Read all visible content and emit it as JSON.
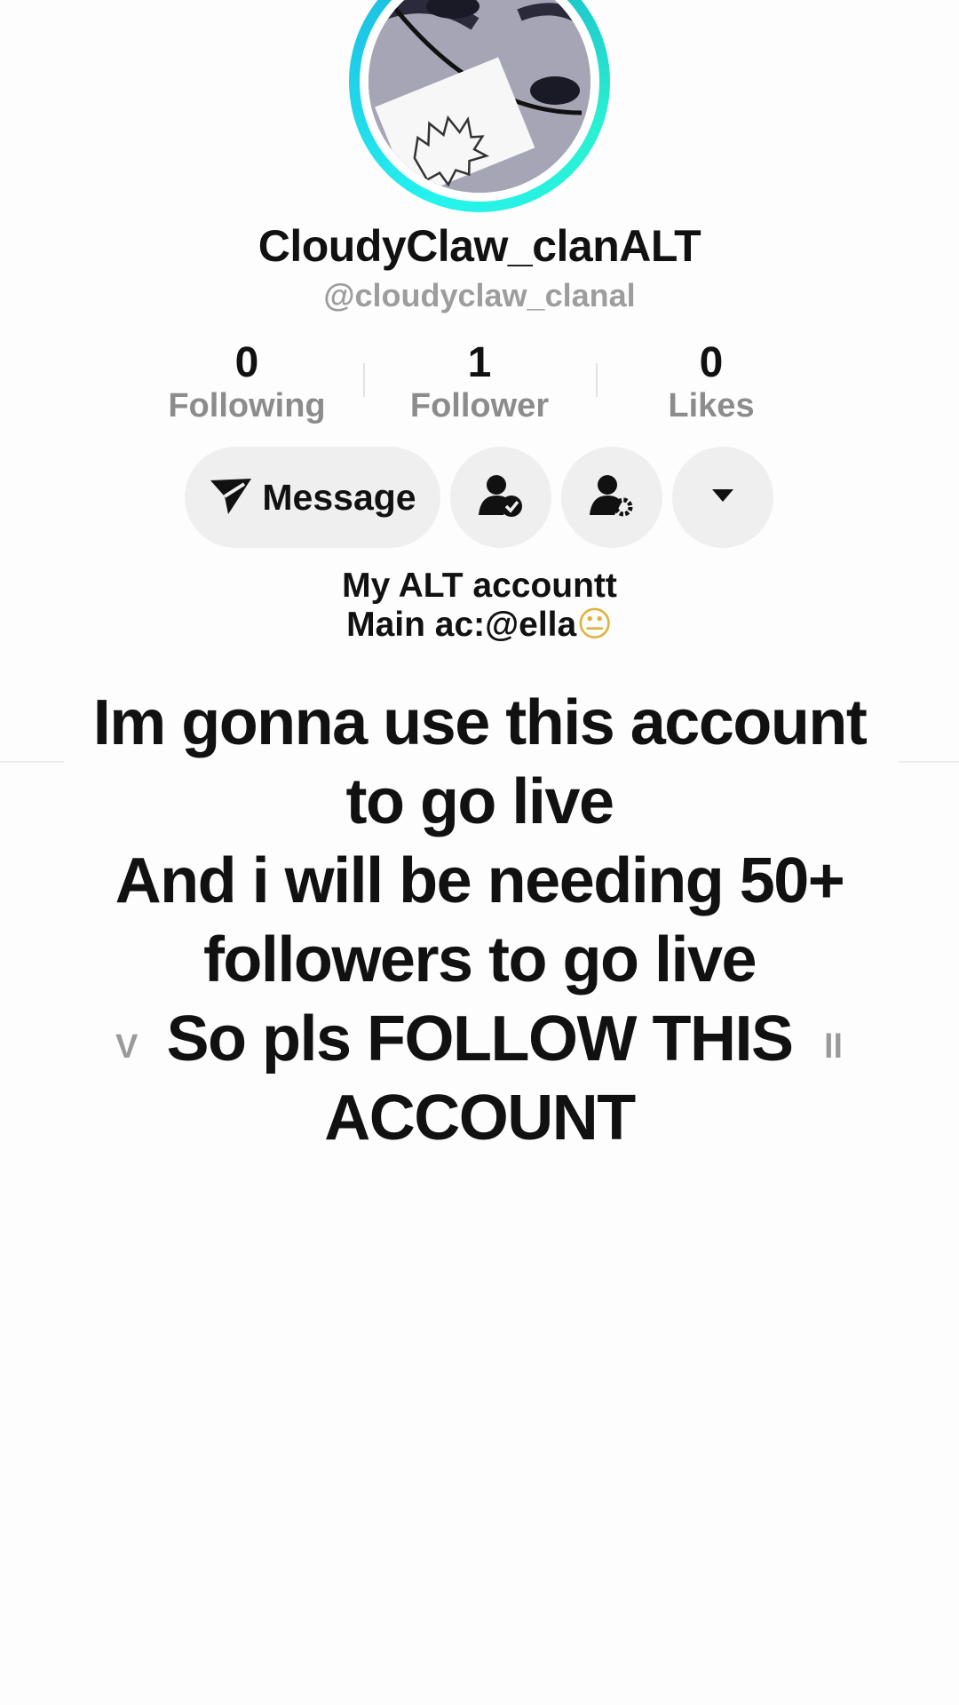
{
  "profile": {
    "display_name": "CloudyClaw_clanALT",
    "handle": "@cloudyclaw_clanal",
    "ring_colors": [
      "#25f4ee",
      "#18b7c9"
    ]
  },
  "stats": [
    {
      "value": "0",
      "label": "Following"
    },
    {
      "value": "1",
      "label": "Follower"
    },
    {
      "value": "0",
      "label": "Likes"
    }
  ],
  "actions": {
    "message_label": "Message",
    "message_icon": "send-icon",
    "friends_icon": "user-check-icon",
    "settings_icon": "user-gear-icon",
    "more_icon": "caret-down-icon"
  },
  "bio": {
    "line1": "My ALT accountt",
    "line2": "Main ac:@ella",
    "emoji": "😐"
  },
  "caption": {
    "line1": "Im gonna use this account",
    "line2": "to go live",
    "line3": "And i will be needing 50+",
    "line4": "followers to go live",
    "line5": "So pls FOLLOW THIS",
    "line6": "ACCOUNT"
  },
  "side_glyphs": {
    "left": "V",
    "right": "ll"
  }
}
